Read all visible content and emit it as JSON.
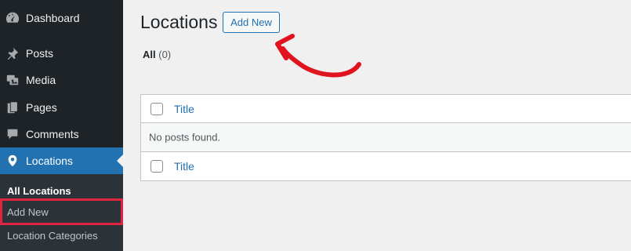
{
  "sidebar": {
    "items": [
      {
        "label": "Dashboard",
        "icon": "dashboard-icon"
      },
      {
        "label": "Posts",
        "icon": "pin-icon"
      },
      {
        "label": "Media",
        "icon": "media-icon"
      },
      {
        "label": "Pages",
        "icon": "pages-icon"
      },
      {
        "label": "Comments",
        "icon": "comments-icon"
      },
      {
        "label": "Locations",
        "icon": "location-icon"
      }
    ],
    "submenu": [
      {
        "label": "All Locations"
      },
      {
        "label": "Add New"
      },
      {
        "label": "Location Categories"
      }
    ]
  },
  "header": {
    "title": "Locations",
    "add_new_label": "Add New"
  },
  "filters": {
    "all_label": "All",
    "all_count": "(0)"
  },
  "table": {
    "header_title": "Title",
    "empty_message": "No posts found.",
    "footer_title": "Title"
  },
  "colors": {
    "sidebar_bg": "#1d2327",
    "submenu_bg": "#2c3338",
    "accent": "#2271b1",
    "highlight": "#e0233f",
    "annotation_arrow": "#e0141e"
  }
}
